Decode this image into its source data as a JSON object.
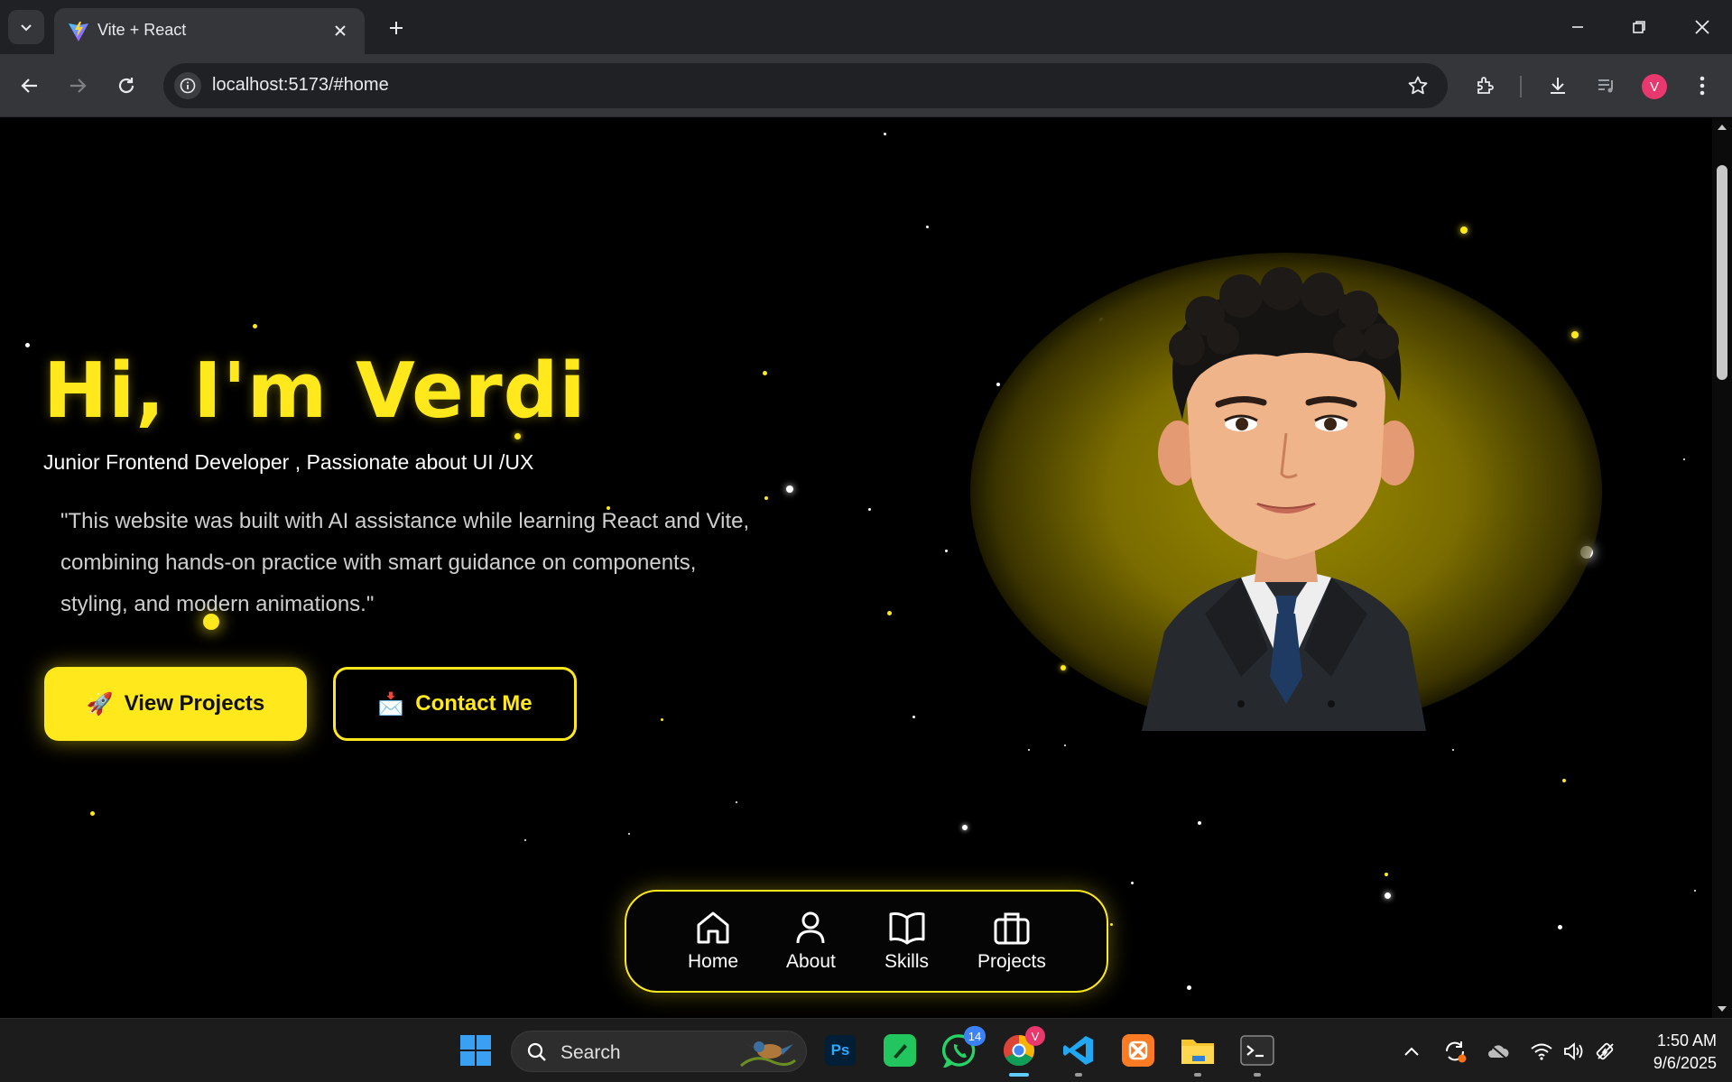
{
  "browser": {
    "tab_title": "Vite + React",
    "url": "localhost:5173/#home",
    "profile_initial": "V"
  },
  "hero": {
    "title": "Hi, I'm Verdi",
    "subtitle": "Junior Frontend Developer , Passionate about UI /UX",
    "quote_lines": [
      "\"This website was built with AI assistance while learning React and Vite,",
      "combining hands-on practice with smart guidance on components,",
      "styling, and modern animations.\""
    ],
    "primary_button": "View Projects",
    "primary_emoji": "🚀",
    "secondary_button": "Contact Me",
    "secondary_emoji": "📩"
  },
  "bottom_nav": {
    "items": [
      {
        "label": "Home",
        "icon": "home-icon"
      },
      {
        "label": "About",
        "icon": "user-icon"
      },
      {
        "label": "Skills",
        "icon": "book-icon"
      },
      {
        "label": "Projects",
        "icon": "briefcase-icon"
      }
    ]
  },
  "taskbar": {
    "search_label": "Search",
    "whatsapp_badge": "14",
    "chrome_badge": "V",
    "time": "1:50 AM",
    "date": "9/6/2025"
  },
  "colors": {
    "accent": "#ffe81c",
    "background": "#000000"
  }
}
